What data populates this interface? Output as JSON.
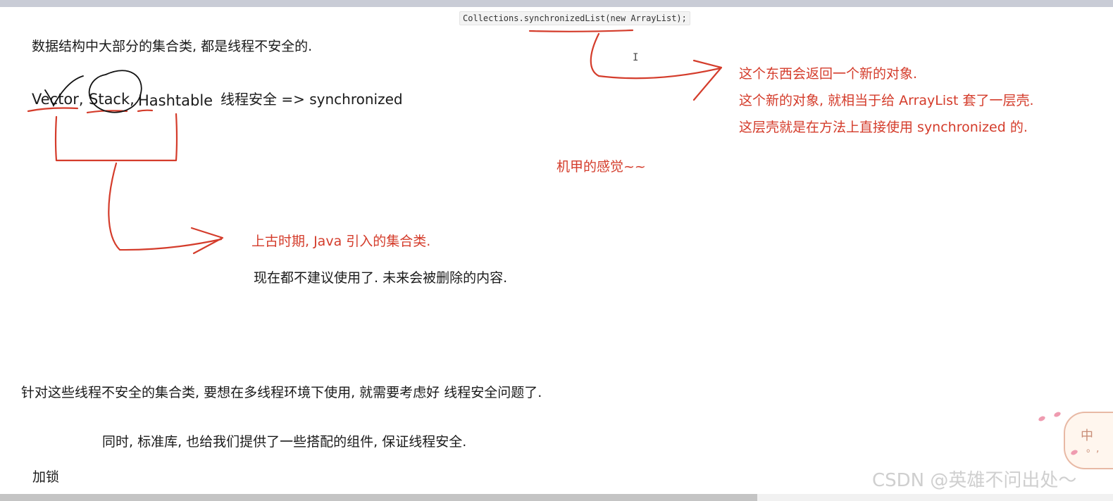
{
  "code_snippet": "Collections.synchronizedList(new ArrayList);",
  "line1": "数据结构中大部分的集合类, 都是线程不安全的.",
  "classes": {
    "vector": "Vector,",
    "stack": "Stack,",
    "hashtable": "Hashtable",
    "note": "线程安全 => synchronized"
  },
  "right_notes": {
    "line1": "这个东西会返回一个新的对象.",
    "line2": "这个新的对象, 就相当于给 ArrayList 套了一层壳.",
    "line3": "这层壳就是在方法上直接使用 synchronized 的."
  },
  "mecha_note": "机甲的感觉~~",
  "ancient_note": "上古时期, Java 引入的集合类.",
  "deprecated_note": "现在都不建议使用了. 未来会被删除的内容.",
  "line_unsafe": "针对这些线程不安全的集合类, 要想在多线程环境下使用, 就需要考虑好 线程安全问题了.",
  "line_stdlib": "同时, 标准库, 也给我们提供了一些搭配的组件, 保证线程安全.",
  "line_lock": "加锁",
  "watermark": "CSDN @英雄不问出处～",
  "mascot_chars": [
    "中",
    "。,"
  ],
  "colors": {
    "annotation_red": "#d43c2b",
    "ink_black": "#111111",
    "text": "#1a1a1a"
  },
  "icons": [
    "text-cursor-icon"
  ]
}
